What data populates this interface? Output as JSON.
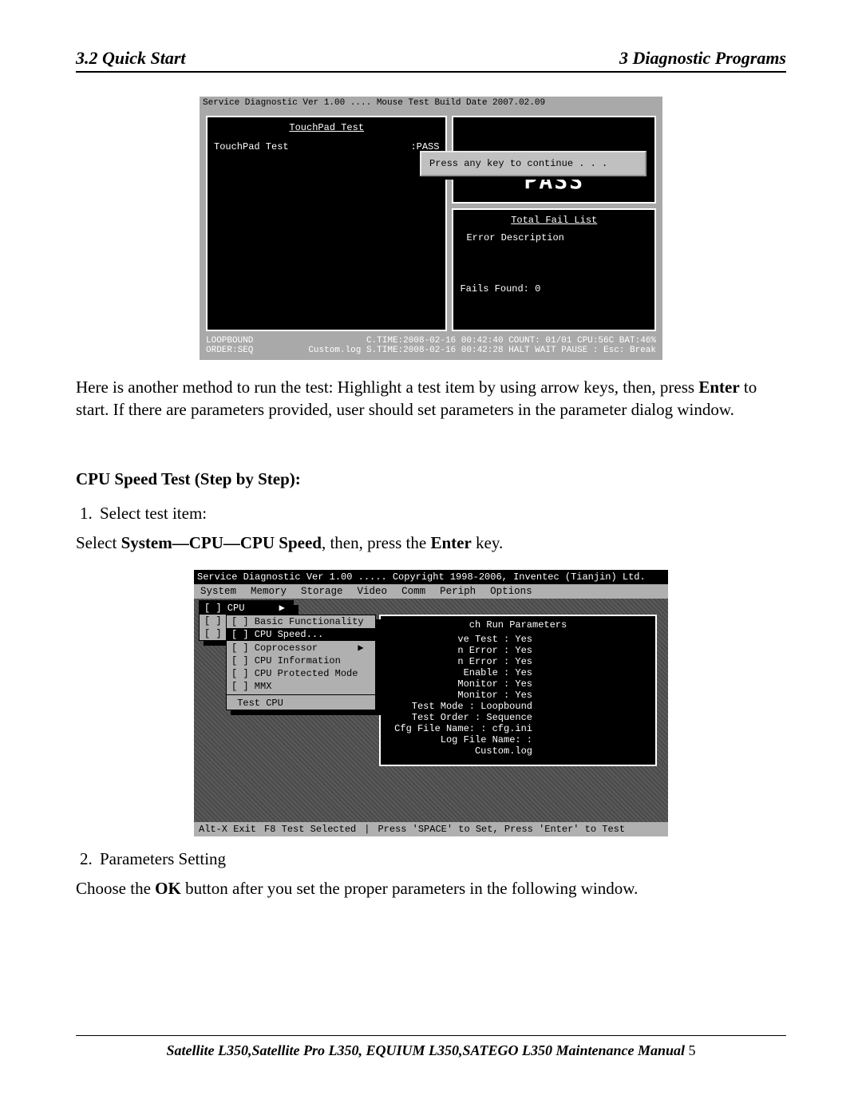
{
  "header": {
    "left": "3.2 Quick Start",
    "right": "3  Diagnostic Programs"
  },
  "shot1": {
    "topbar": "Service Diagnostic Ver 1.00 .... Mouse Test Build Date 2007.02.09",
    "left_title": "TouchPad Test",
    "left_item": "TouchPad Test",
    "left_result": ":PASS",
    "popup": "Press any key to continue . . .",
    "pass_big": "PASS",
    "fail_title": "Total Fail List",
    "fail_cols": "Error   Description",
    "fail_found": "Fails Found: 0",
    "bottom1_left": "LOOPBOUND",
    "bottom1_right": "C.TIME:2008-02-16 00:42:40 COUNT: 01/01  CPU:56C BAT:46%",
    "bottom2_left": "ORDER:SEQ",
    "bottom2_right": "Custom.log S.TIME:2008-02-16 00:42:28 HALT WAIT PAUSE  : Esc: Break"
  },
  "para1_a": "Here is another method to run the test: Highlight a test item by using arrow keys, then, press ",
  "para1_bold": "Enter",
  "para1_b": " to start. If there are parameters provided, user should set parameters in the parameter dialog window.",
  "section_title": "CPU Speed Test (Step by Step):",
  "step1": "Select test item:",
  "step1_line_a": "Select ",
  "step1_bold1": "System—CPU—CPU Speed",
  "step1_line_b": ", then, press the ",
  "step1_bold2": "Enter",
  "step1_line_c": " key.",
  "shot2": {
    "title": "Service Diagnostic Ver 1.00 ..... Copyright 1998-2006, Inventec (Tianjin) Ltd.",
    "menu": [
      "System",
      "Memory",
      "Storage",
      "Video",
      "Comm",
      "Periph",
      "Options"
    ],
    "sys_menu": [
      "[ ] CPU      ▶",
      "[ ]",
      "[ ]"
    ],
    "sub_menu": [
      {
        "t": "[ ] Basic Functionality",
        "hi": false
      },
      {
        "t": "[ ] CPU Speed...",
        "hi": true
      },
      {
        "t": "[ ] Coprocessor       ▶",
        "hi": false
      },
      {
        "t": "[ ] CPU Information",
        "hi": false
      },
      {
        "t": "[ ] CPU Protected Mode",
        "hi": false
      },
      {
        "t": "[ ] MMX",
        "hi": false
      }
    ],
    "sub_footer": " Test CPU",
    "run_hdr": "ch Run Parameters",
    "run_lines": [
      "ve Test : Yes",
      "n Error : Yes",
      "n Error : Yes",
      "Enable : Yes",
      "",
      "Monitor : Yes",
      "Monitor : Yes",
      "",
      "Test Mode : Loopbound",
      "Test Order : Sequence",
      "",
      "Cfg File Name: : cfg.ini",
      "Log File Name: : Custom.log"
    ],
    "status": [
      "Alt-X Exit",
      "F8 Test Selected",
      "|",
      "Press 'SPACE' to Set, Press 'Enter' to Test"
    ]
  },
  "step2": "Parameters Setting",
  "para2_a": "Choose the ",
  "para2_bold": "OK",
  "para2_b": " button after you set the proper parameters in the following window.",
  "footer_book": "Satellite L350,Satellite Pro L350, EQUIUM L350,SATEGO L350 Maintenance Manual",
  "footer_page": " 5"
}
